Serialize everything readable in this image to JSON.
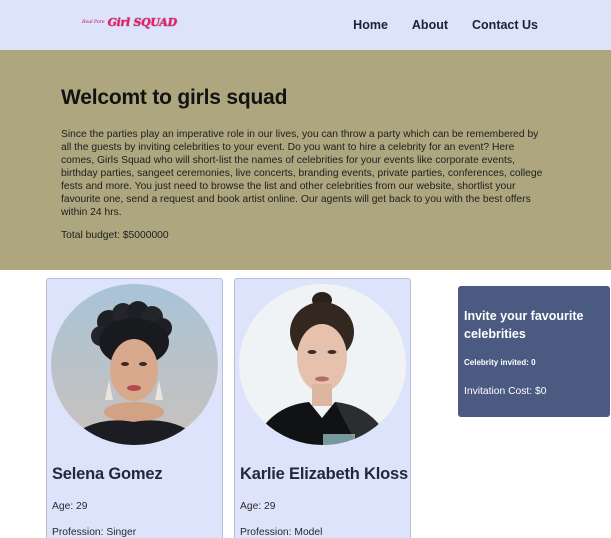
{
  "nav": {
    "logo_small": "Real Pare",
    "logo_big": "Girl SQUAD",
    "links": [
      "Home",
      "About",
      "Contact Us"
    ]
  },
  "hero": {
    "title": "Welcomt to girls squad",
    "description": "Since the parties play an imperative role in our lives, you can throw a party which can be remembered by all the guests by inviting celebrities to your event. Do you want to hire a celebrity for an event? Here comes, Girls Squad who will short-list the names of celebrities for your events like corporate events, birthday parties, sangeet ceremonies, live concerts, branding events, private parties, conferences, college fests and more. You just need to browse the list and other celebrities from our website, shortlist your favourite one, send a request and book artist online. Our agents will get back to you with the best offers within 24 hrs.",
    "budget": "Total budget: $5000000"
  },
  "cards": [
    {
      "name": "Selena Gomez",
      "age": "Age: 29",
      "profession": "Profession: Singer"
    },
    {
      "name": "Karlie Elizabeth Kloss",
      "age": "Age: 29",
      "profession": "Profession: Model"
    }
  ],
  "invite": {
    "title": "Invite your favourite celebrities",
    "count": "Celebrity invited: 0",
    "cost": "Invitation Cost: $0"
  },
  "colors": {
    "nav_bg": "#dde3fb",
    "hero_bg": "#ada67f",
    "invite_bg": "#4a5a81",
    "logo_pink": "#e91e63"
  }
}
